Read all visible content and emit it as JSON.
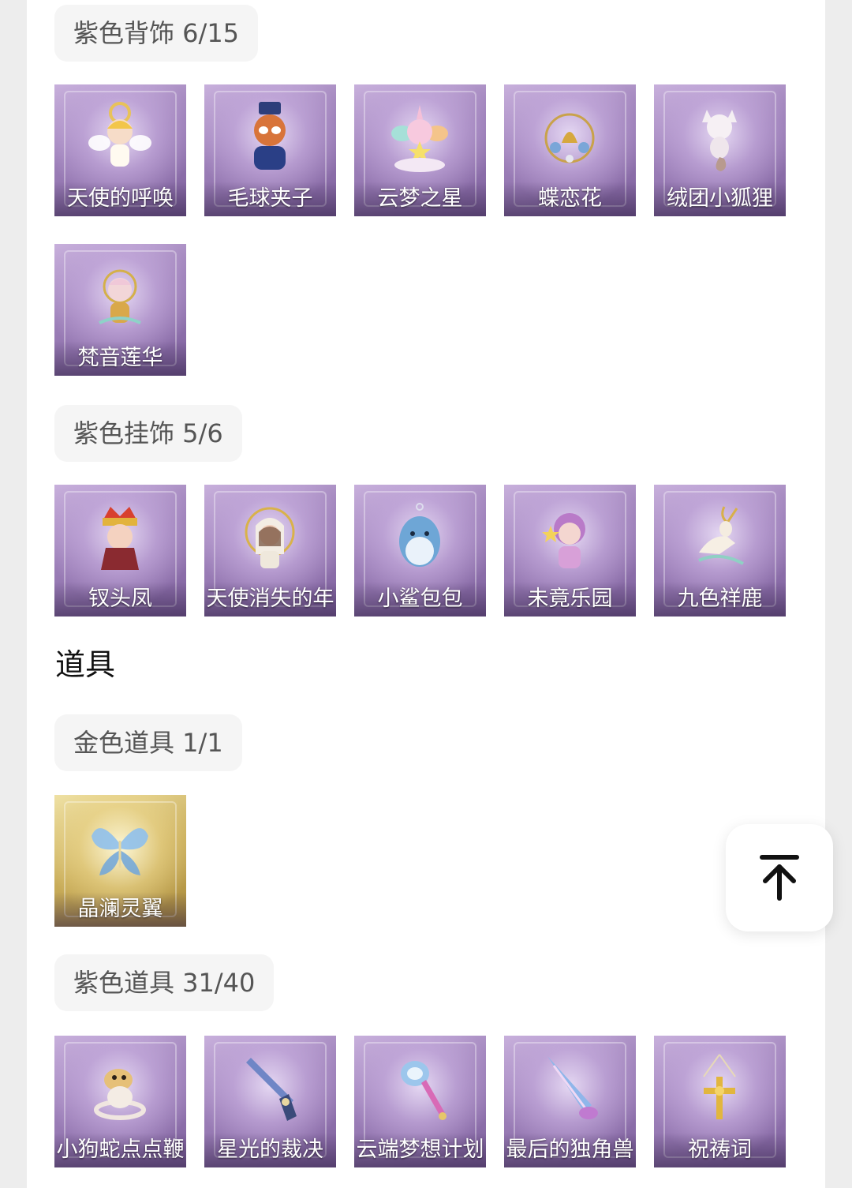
{
  "sections": {
    "purple_back": {
      "chip": "紫色背饰 6/15",
      "items": [
        "天使的呼唤",
        "毛球夹子",
        "云梦之星",
        "蝶恋花",
        "绒团小狐狸",
        "梵音莲华"
      ]
    },
    "purple_hanging": {
      "chip": "紫色挂饰 5/6",
      "items": [
        "钗头凤",
        "天使消失的年",
        "小鲨包包",
        "未竟乐园",
        "九色祥鹿"
      ]
    },
    "props": {
      "title": "道具"
    },
    "gold_props": {
      "chip": "金色道具 1/1",
      "items": [
        "晶澜灵翼"
      ]
    },
    "purple_props": {
      "chip": "紫色道具 31/40",
      "items": [
        "小狗蛇点点鞭",
        "星光的裁决",
        "云端梦想计划",
        "最后的独角兽",
        "祝祷词"
      ]
    }
  },
  "colors": {
    "purple_tile": "#9c7fb8",
    "gold_tile": "#c9ad5a",
    "chip_bg": "#f5f5f5"
  },
  "icons": {
    "back_to_top": "arrow-up-to-line-icon"
  }
}
